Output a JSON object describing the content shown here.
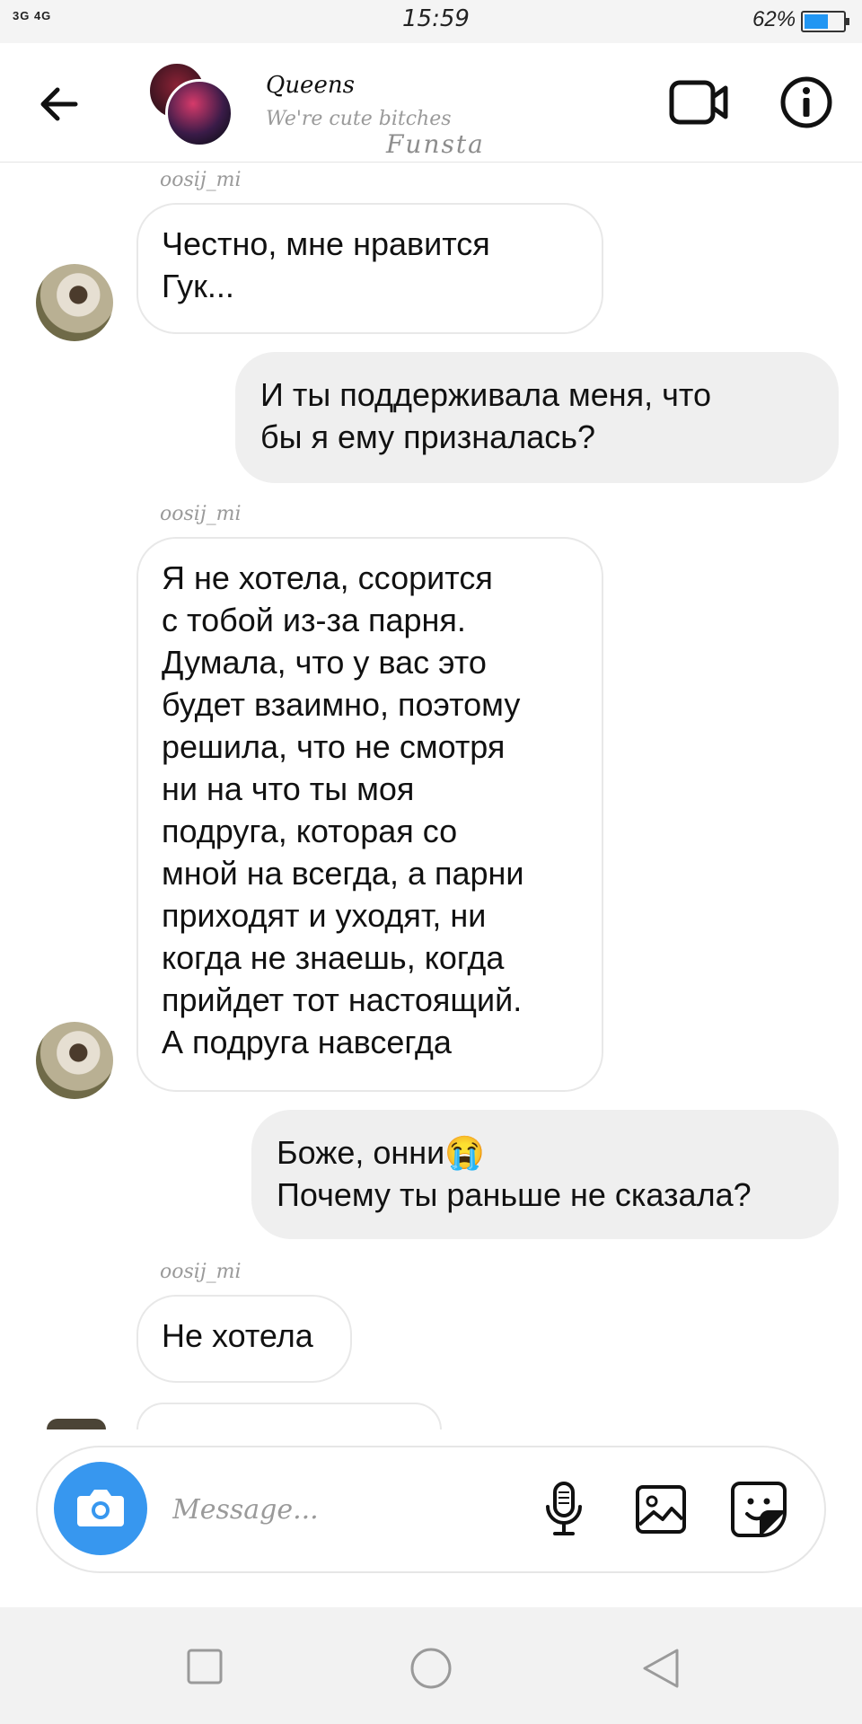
{
  "status_bar": {
    "signal": "3G 4G",
    "time": "15:59",
    "battery": "62%",
    "battery_level": 0.62
  },
  "header": {
    "title": "Queens",
    "subtitle": "We're cute bitches",
    "watermark": "Funsta"
  },
  "messages": [
    {
      "sender": "oosij_mi",
      "direction": "in",
      "lines": [
        "Честно, мне нравится",
        "Гук..."
      ]
    },
    {
      "direction": "out",
      "lines": [
        "И ты поддерживала меня, что",
        "бы я ему призналась?"
      ]
    },
    {
      "sender": "oosij_mi",
      "direction": "in",
      "lines": [
        "Я не хотела, ссорится",
        "с тобой из-за парня.",
        "Думала, что у вас это",
        "будет взаимно, поэтому",
        "решила, что не смотря",
        "ни на что ты моя",
        "подруга, которая со",
        "мной на всегда, а парни",
        "приходят и уходят, ни",
        "когда не знаешь, когда",
        "прийдет тот настоящий.",
        "А подруга навсегда"
      ]
    },
    {
      "direction": "out",
      "lines": [
        "Боже, онни😭",
        "Почему ты раньше не сказала?"
      ]
    },
    {
      "sender": "oosij_mi",
      "direction": "in",
      "lines": [
        "Не хотела"
      ]
    }
  ],
  "composer": {
    "placeholder": "Message..."
  },
  "icons": {
    "back": "arrow-left-icon",
    "video": "video-camera-icon",
    "info": "info-icon",
    "camera": "camera-icon",
    "mic": "microphone-icon",
    "gallery": "image-icon",
    "sticker": "sticker-icon"
  },
  "colors": {
    "accent": "#3797ef",
    "bubble_out": "#efefef",
    "muted_text": "#9a9a9a"
  }
}
